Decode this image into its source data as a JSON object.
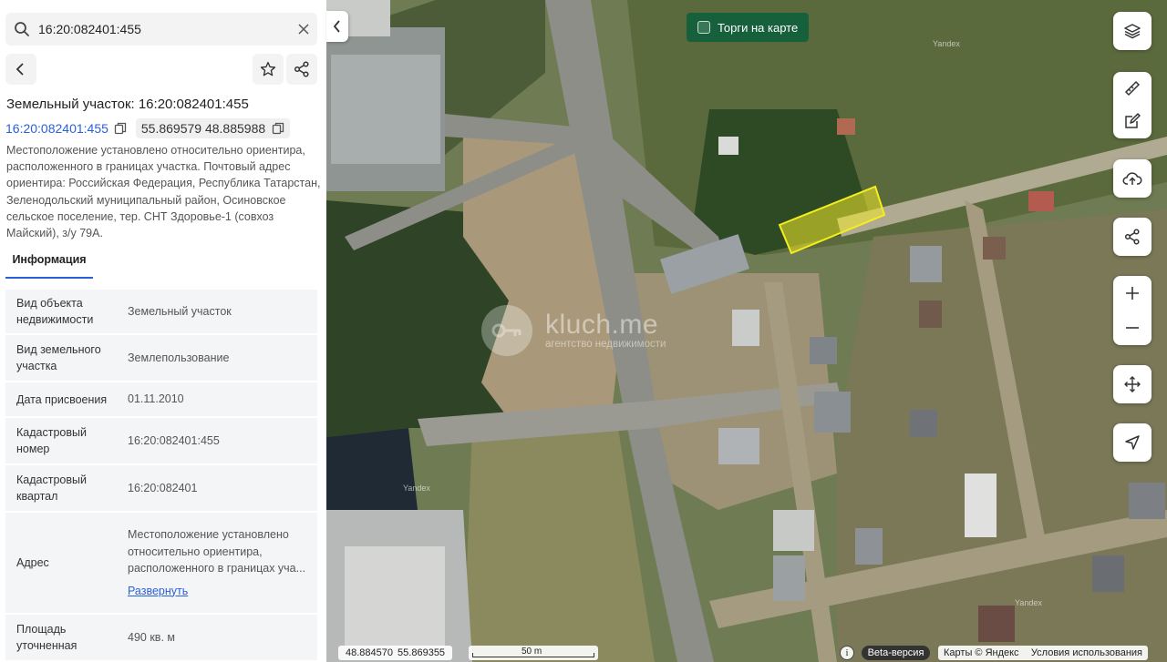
{
  "search": {
    "value": "16:20:082401:455"
  },
  "header": {
    "title": "Земельный участок: 16:20:082401:455"
  },
  "cadastral": {
    "number_link": "16:20:082401:455",
    "coordinates": "55.869579 48.885988"
  },
  "description": "Местоположение установлено относительно ориентира, расположенного в границах участка. Почтовый адрес ориентира: Российская Федерация, Республика Татарстан, Зеленодольский муниципальный район, Осиновское сельское поселение, тер. СНТ Здоровье-1 (совхоз Майский), з/у 79А.",
  "tabs": [
    {
      "label": "Информация",
      "active": true
    }
  ],
  "info": {
    "rows": [
      {
        "label": "Вид объекта недвижимости",
        "value": "Земельный участок"
      },
      {
        "label": "Вид земельного участка",
        "value": "Землепользование"
      },
      {
        "label": "Дата присвоения",
        "value": "01.11.2010"
      },
      {
        "label": "Кадастровый номер",
        "value": "16:20:082401:455"
      },
      {
        "label": "Кадастровый квартал",
        "value": "16:20:082401"
      },
      {
        "label": "Адрес",
        "value": "Местоположение установлено относительно ориентира, расположенного в границах уча...",
        "link": "Развернуть"
      },
      {
        "label": "Площадь уточненная",
        "value": "490 кв. м"
      }
    ]
  },
  "map": {
    "torgi_label": "Торги на карте",
    "watermark": {
      "brand": "kluch.me",
      "tagline": "агентство недвижимости"
    },
    "yandex_watermark": "Yandex",
    "bottom_coords": "48.884570  55.869355",
    "scale_label": "50 m",
    "info_symbol": "i",
    "beta_label": "Beta-версия",
    "attribution": "Карты © Яндекс",
    "terms_link": "Условия использования",
    "controls": [
      "layers-icon",
      "ruler-icon",
      "edit-icon",
      "upload-icon",
      "share-icon",
      "zoom-in-icon",
      "zoom-out-icon",
      "move-icon",
      "locate-icon"
    ],
    "highlight_color": "#f2ea2a"
  }
}
